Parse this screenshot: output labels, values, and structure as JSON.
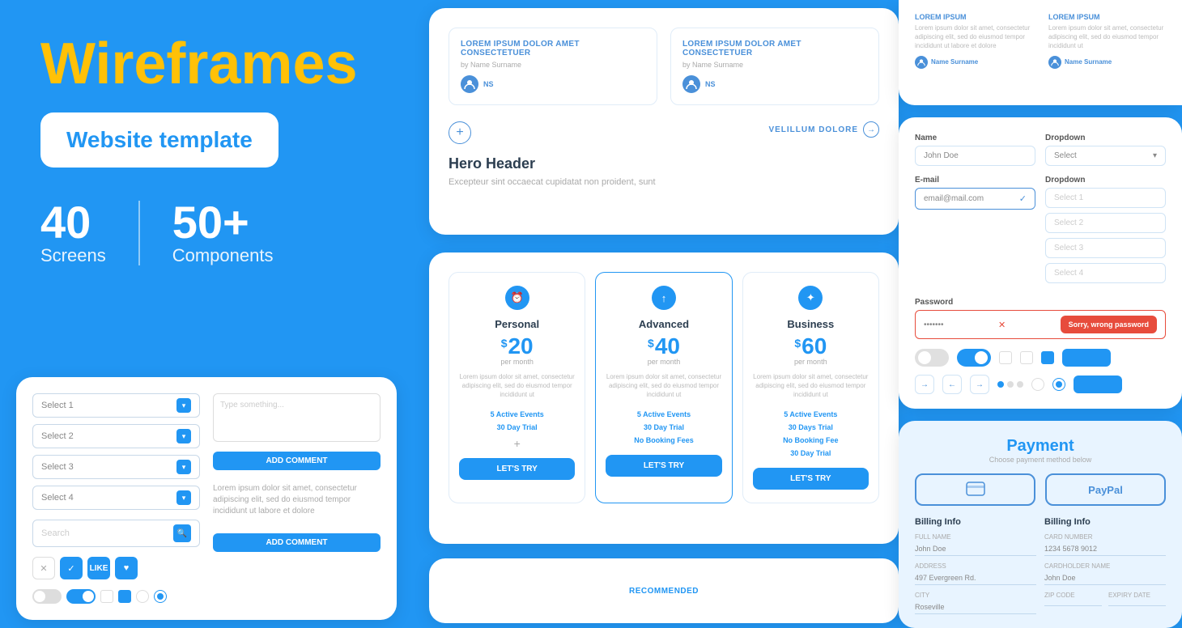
{
  "header": {
    "title": "Wireframes",
    "subtitle": "Website template"
  },
  "stats": {
    "screens_count": "40",
    "screens_label": "Screens",
    "components_count": "50+",
    "components_label": "Components"
  },
  "colors": {
    "primary": "#2196F3",
    "accent": "#FFC107",
    "white": "#ffffff"
  },
  "center_top": {
    "blog_card_1": {
      "title": "LOREM IPSUM DOLOR AMET CONSECTETUER",
      "sub": "by Name Surname",
      "author": "NS"
    },
    "blog_card_2": {
      "title": "LOREM IPSUM DOLOR AMET CONSECTETUER",
      "sub": "by Name Surname",
      "author": "NS"
    },
    "link_text": "VELILLUM DOLORE",
    "hero_header": "Hero Header",
    "hero_sub": "Excepteur sint occaecat cupidatat non proident, sunt"
  },
  "pricing": {
    "plans": [
      {
        "name": "Personal",
        "price": "20",
        "period": "per month",
        "desc": "Lorem ipsum dolor sit amet, consectetur adipiscing elit, sed do eiusmod tempor incididunt ut",
        "features": [
          "5 Active Events",
          "30 Day Trial"
        ],
        "cta": "LET'S TRY"
      },
      {
        "name": "Advanced",
        "price": "40",
        "period": "per month",
        "desc": "Lorem ipsum dolor sit amet, consectetur adipiscing elit, sed do eiusmod tempor incididunt ut",
        "features": [
          "5 Active Events",
          "30 Day Trial",
          "No Booking Fees"
        ],
        "cta": "LET'S TRY"
      },
      {
        "name": "Business",
        "price": "60",
        "period": "per month",
        "desc": "Lorem ipsum dolor sit amet, consectetur adipiscing elit, sed do eiusmod tempor incididunt ut",
        "features": [
          "5 Active Events",
          "30 Days Trial",
          "No Booking Fee",
          "30 Day Trial"
        ],
        "cta": "LET'S TRY"
      }
    ]
  },
  "right_blog": {
    "item1_title": "LOREM IPSUM",
    "item1_desc": "Lorem ipsum dolor sit amet, consectetur adipiscing elit, sed do eiusmod tempor incididunt ut labore et dolore",
    "item1_author": "Name Surname",
    "item2_title": "LOREM IPSUM",
    "item2_desc": "Lorem ipsum dolor sit amet, consectetur adipiscing elit, sed do eiusmod tempor incididunt ut",
    "item2_author": "Name Surname"
  },
  "right_form": {
    "name_label": "Name",
    "name_value": "John Doe",
    "email_label": "E-mail",
    "email_value": "email@mail.com",
    "password_label": "Password",
    "password_value": "•••••••",
    "error_text": "Sorry, wrong password",
    "dropdown1_label": "Dropdown",
    "dropdown1_value": "Select",
    "dropdown2_label": "Dropdown",
    "dropdown2_value": "Select 1",
    "dropdown3_value": "Select 2",
    "dropdown4_value": "Select 3",
    "dropdown5_value": "Select 4"
  },
  "left_form": {
    "select_items": [
      "Select 1",
      "Select 2",
      "Select 3",
      "Select 4"
    ],
    "search_placeholder": "Search",
    "textarea_placeholder": "Type something...",
    "add_comment_label": "ADD COMMENT",
    "lorem_text": "Lorem ipsum dolor sit amet, consectetur adipiscing elit, sed do eiusmod tempor incididunt ut labore et dolore"
  },
  "payment": {
    "title": "Payment",
    "subtitle": "Choose payment method below",
    "method_card_icon": "▦",
    "method_paypal": "PayPal",
    "billing_section": "Billing Info",
    "fields": {
      "full_name_label": "FULL NAME",
      "full_name_value": "John Doe",
      "address_label": "ADDRESS",
      "address_value": "497 Evergreen Rd.",
      "city_label": "CITY",
      "city_value": "Roseville",
      "card_number_label": "CARD NUMBER",
      "card_number_value": "1234  5678  9012",
      "cardholder_label": "CARDHOLDER NAME",
      "cardholder_value": "John Doe",
      "zip_label": "ZIP CODE",
      "zip_value": "",
      "expiry_label": "EXPIRY DATE",
      "expiry_value": ""
    }
  }
}
